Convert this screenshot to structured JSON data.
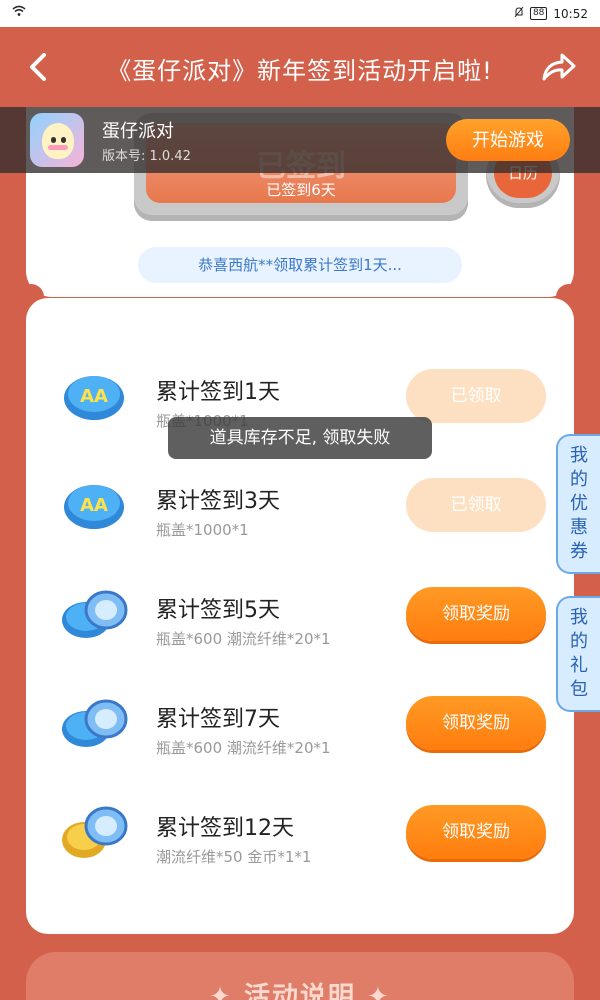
{
  "statusbar": {
    "time": "10:52",
    "battery": "88"
  },
  "header": {
    "title": "《蛋仔派对》新年签到活动开启啦!"
  },
  "app": {
    "name": "蛋仔派对",
    "version": "版本号: 1.0.42",
    "play_label": "开始游戏"
  },
  "signin": {
    "big_label": "已签到",
    "days_label": "已签到6天",
    "calendar_label": "日历"
  },
  "notice": "恭喜西航**领取累计签到1天...",
  "rewards": [
    {
      "title": "累计签到1天",
      "items": "瓶盖*1000*1",
      "button": "已领取",
      "state": "claimed",
      "icon": "bottle-cap"
    },
    {
      "title": "累计签到3天",
      "items": "瓶盖*1000*1",
      "button": "已领取",
      "state": "claimed",
      "icon": "bottle-cap"
    },
    {
      "title": "累计签到5天",
      "items": "瓶盖*600 潮流纤维*20*1",
      "button": "领取奖励",
      "state": "active",
      "icon": "cap-and-fiber"
    },
    {
      "title": "累计签到7天",
      "items": "瓶盖*600 潮流纤维*20*1",
      "button": "领取奖励",
      "state": "active",
      "icon": "cap-and-fiber"
    },
    {
      "title": "累计签到12天",
      "items": "潮流纤维*50 金币*1*1",
      "button": "领取奖励",
      "state": "active",
      "icon": "coin-and-fiber"
    }
  ],
  "toast": "道具库存不足, 领取失败",
  "side_tabs": {
    "coupons": "我的优惠券",
    "gifts": "我的礼包"
  },
  "footer": {
    "label": "✦ 活动说明 ✦"
  },
  "colors": {
    "background": "#d2604a",
    "accent_orange": "#ff8a1a",
    "claimed": "#fde0c2",
    "notice_text": "#3b78c9"
  }
}
